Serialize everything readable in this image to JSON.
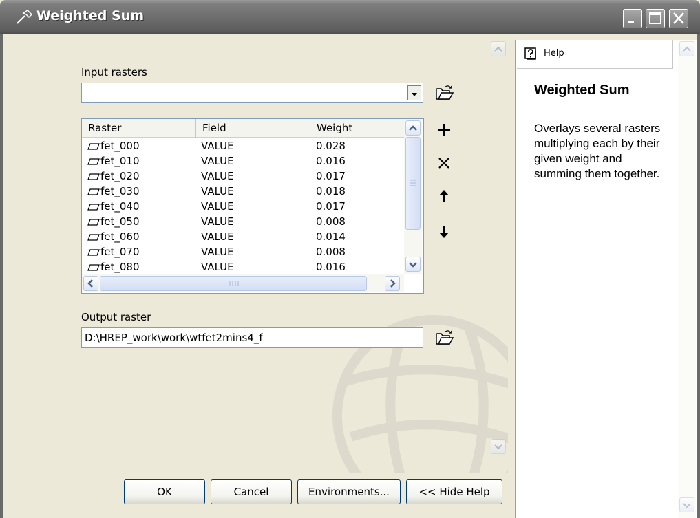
{
  "window": {
    "title": "Weighted Sum"
  },
  "input_rasters": {
    "label": "Input rasters",
    "value": ""
  },
  "table": {
    "columns": [
      "Raster",
      "Field",
      "Weight"
    ],
    "rows": [
      {
        "raster": "fet_000",
        "field": "VALUE",
        "weight": "0.028"
      },
      {
        "raster": "fet_010",
        "field": "VALUE",
        "weight": "0.016"
      },
      {
        "raster": "fet_020",
        "field": "VALUE",
        "weight": "0.017"
      },
      {
        "raster": "fet_030",
        "field": "VALUE",
        "weight": "0.018"
      },
      {
        "raster": "fet_040",
        "field": "VALUE",
        "weight": "0.017"
      },
      {
        "raster": "fet_050",
        "field": "VALUE",
        "weight": "0.008"
      },
      {
        "raster": "fet_060",
        "field": "VALUE",
        "weight": "0.014"
      },
      {
        "raster": "fet_070",
        "field": "VALUE",
        "weight": "0.008"
      },
      {
        "raster": "fet_080",
        "field": "VALUE",
        "weight": "0.016"
      }
    ]
  },
  "output_raster": {
    "label": "Output raster",
    "value": "D:\\HREP_work\\work\\wtfet2mins4_f"
  },
  "buttons": {
    "ok": "OK",
    "cancel": "Cancel",
    "environments": "Environments...",
    "hide_help": "<< Hide Help"
  },
  "help": {
    "tab_label": "Help",
    "title": "Weighted Sum",
    "body": "Overlays several rasters multiplying each by their given weight and summing them together."
  },
  "icons": {
    "title": "hammer-icon",
    "browse": "open-folder-icon",
    "add": "plus-icon",
    "remove": "x-icon",
    "up": "arrow-up-icon",
    "down": "arrow-down-icon",
    "help_tab": "help-question-icon"
  }
}
